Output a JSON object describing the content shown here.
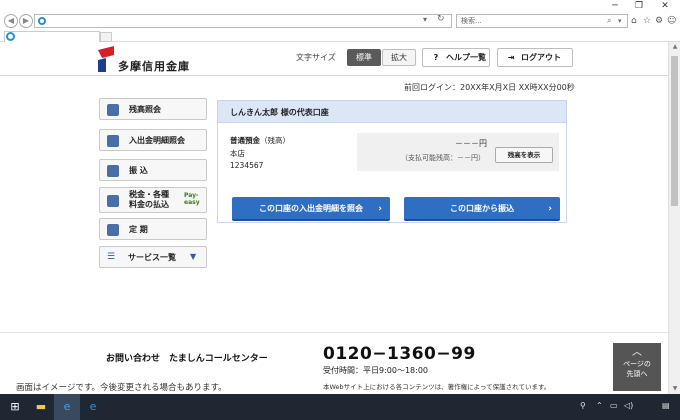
{
  "browser": {
    "search_placeholder": "検索...",
    "window_controls": [
      "minimize-icon",
      "restore-icon",
      "close-icon"
    ],
    "toolbar_icons": [
      "home-icon",
      "star-icon",
      "gear-icon",
      "smiley-icon"
    ]
  },
  "header": {
    "brand": "多摩信用金庫",
    "fontsize_label": "文字サイズ",
    "fontsize_standard": "標準",
    "fontsize_large": "拡大",
    "help_icon": "?",
    "help_label": "ヘルプ一覧",
    "logout_label": "ログアウト"
  },
  "last_login": "前回ログイン：20XX年X月X日 XX時XX分00秒",
  "side_menu": {
    "balance": "残高照会",
    "statement": "入出金明細照会",
    "transfer": "振 込",
    "tax_line1": "税金・各種",
    "tax_line2": "料金の払込",
    "payeasy": "Pay-easy",
    "time_deposit": "定 期",
    "services": "サービス一覧"
  },
  "account": {
    "title": "しんきん太郎 様の代表口座",
    "type": "普通預金",
    "type_note": "（残高）",
    "branch": "本店",
    "number": "1234567",
    "balance_masked": "－－－円",
    "available_masked": "（支払可能残高：－－円）",
    "show_balance_button": "残高を表示",
    "statement_button": "この口座の入出金明細を照会",
    "transfer_button": "この口座から振込"
  },
  "footer": {
    "inquiry": "お問い合わせ　たましんコールセンター",
    "phone": "0120−1360−99",
    "hours": "受付時間：平日9:00〜18:00",
    "copyright": "本Webサイト上における各コンテンツは、著作権によって保護されています。",
    "disclaimer": "画面はイメージです。今後変更される場合もあります。",
    "page_top_line1": "ページの",
    "page_top_line2": "先頭へ"
  },
  "colors": {
    "accent_blue": "#2f6fc3",
    "panel_head": "#dbe6f6",
    "logo_red": "#d61f26",
    "taskbar": "#1f2733"
  }
}
